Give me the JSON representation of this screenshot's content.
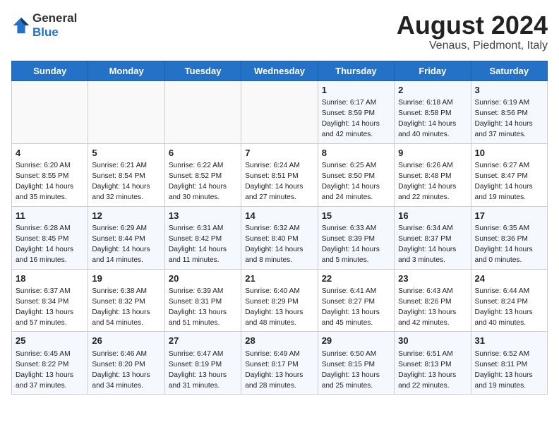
{
  "header": {
    "logo_general": "General",
    "logo_blue": "Blue",
    "month_year": "August 2024",
    "location": "Venaus, Piedmont, Italy"
  },
  "days_of_week": [
    "Sunday",
    "Monday",
    "Tuesday",
    "Wednesday",
    "Thursday",
    "Friday",
    "Saturday"
  ],
  "weeks": [
    [
      {
        "day": "",
        "info": ""
      },
      {
        "day": "",
        "info": ""
      },
      {
        "day": "",
        "info": ""
      },
      {
        "day": "",
        "info": ""
      },
      {
        "day": "1",
        "info": "Sunrise: 6:17 AM\nSunset: 8:59 PM\nDaylight: 14 hours\nand 42 minutes."
      },
      {
        "day": "2",
        "info": "Sunrise: 6:18 AM\nSunset: 8:58 PM\nDaylight: 14 hours\nand 40 minutes."
      },
      {
        "day": "3",
        "info": "Sunrise: 6:19 AM\nSunset: 8:56 PM\nDaylight: 14 hours\nand 37 minutes."
      }
    ],
    [
      {
        "day": "4",
        "info": "Sunrise: 6:20 AM\nSunset: 8:55 PM\nDaylight: 14 hours\nand 35 minutes."
      },
      {
        "day": "5",
        "info": "Sunrise: 6:21 AM\nSunset: 8:54 PM\nDaylight: 14 hours\nand 32 minutes."
      },
      {
        "day": "6",
        "info": "Sunrise: 6:22 AM\nSunset: 8:52 PM\nDaylight: 14 hours\nand 30 minutes."
      },
      {
        "day": "7",
        "info": "Sunrise: 6:24 AM\nSunset: 8:51 PM\nDaylight: 14 hours\nand 27 minutes."
      },
      {
        "day": "8",
        "info": "Sunrise: 6:25 AM\nSunset: 8:50 PM\nDaylight: 14 hours\nand 24 minutes."
      },
      {
        "day": "9",
        "info": "Sunrise: 6:26 AM\nSunset: 8:48 PM\nDaylight: 14 hours\nand 22 minutes."
      },
      {
        "day": "10",
        "info": "Sunrise: 6:27 AM\nSunset: 8:47 PM\nDaylight: 14 hours\nand 19 minutes."
      }
    ],
    [
      {
        "day": "11",
        "info": "Sunrise: 6:28 AM\nSunset: 8:45 PM\nDaylight: 14 hours\nand 16 minutes."
      },
      {
        "day": "12",
        "info": "Sunrise: 6:29 AM\nSunset: 8:44 PM\nDaylight: 14 hours\nand 14 minutes."
      },
      {
        "day": "13",
        "info": "Sunrise: 6:31 AM\nSunset: 8:42 PM\nDaylight: 14 hours\nand 11 minutes."
      },
      {
        "day": "14",
        "info": "Sunrise: 6:32 AM\nSunset: 8:40 PM\nDaylight: 14 hours\nand 8 minutes."
      },
      {
        "day": "15",
        "info": "Sunrise: 6:33 AM\nSunset: 8:39 PM\nDaylight: 14 hours\nand 5 minutes."
      },
      {
        "day": "16",
        "info": "Sunrise: 6:34 AM\nSunset: 8:37 PM\nDaylight: 14 hours\nand 3 minutes."
      },
      {
        "day": "17",
        "info": "Sunrise: 6:35 AM\nSunset: 8:36 PM\nDaylight: 14 hours\nand 0 minutes."
      }
    ],
    [
      {
        "day": "18",
        "info": "Sunrise: 6:37 AM\nSunset: 8:34 PM\nDaylight: 13 hours\nand 57 minutes."
      },
      {
        "day": "19",
        "info": "Sunrise: 6:38 AM\nSunset: 8:32 PM\nDaylight: 13 hours\nand 54 minutes."
      },
      {
        "day": "20",
        "info": "Sunrise: 6:39 AM\nSunset: 8:31 PM\nDaylight: 13 hours\nand 51 minutes."
      },
      {
        "day": "21",
        "info": "Sunrise: 6:40 AM\nSunset: 8:29 PM\nDaylight: 13 hours\nand 48 minutes."
      },
      {
        "day": "22",
        "info": "Sunrise: 6:41 AM\nSunset: 8:27 PM\nDaylight: 13 hours\nand 45 minutes."
      },
      {
        "day": "23",
        "info": "Sunrise: 6:43 AM\nSunset: 8:26 PM\nDaylight: 13 hours\nand 42 minutes."
      },
      {
        "day": "24",
        "info": "Sunrise: 6:44 AM\nSunset: 8:24 PM\nDaylight: 13 hours\nand 40 minutes."
      }
    ],
    [
      {
        "day": "25",
        "info": "Sunrise: 6:45 AM\nSunset: 8:22 PM\nDaylight: 13 hours\nand 37 minutes."
      },
      {
        "day": "26",
        "info": "Sunrise: 6:46 AM\nSunset: 8:20 PM\nDaylight: 13 hours\nand 34 minutes."
      },
      {
        "day": "27",
        "info": "Sunrise: 6:47 AM\nSunset: 8:19 PM\nDaylight: 13 hours\nand 31 minutes."
      },
      {
        "day": "28",
        "info": "Sunrise: 6:49 AM\nSunset: 8:17 PM\nDaylight: 13 hours\nand 28 minutes."
      },
      {
        "day": "29",
        "info": "Sunrise: 6:50 AM\nSunset: 8:15 PM\nDaylight: 13 hours\nand 25 minutes."
      },
      {
        "day": "30",
        "info": "Sunrise: 6:51 AM\nSunset: 8:13 PM\nDaylight: 13 hours\nand 22 minutes."
      },
      {
        "day": "31",
        "info": "Sunrise: 6:52 AM\nSunset: 8:11 PM\nDaylight: 13 hours\nand 19 minutes."
      }
    ]
  ]
}
